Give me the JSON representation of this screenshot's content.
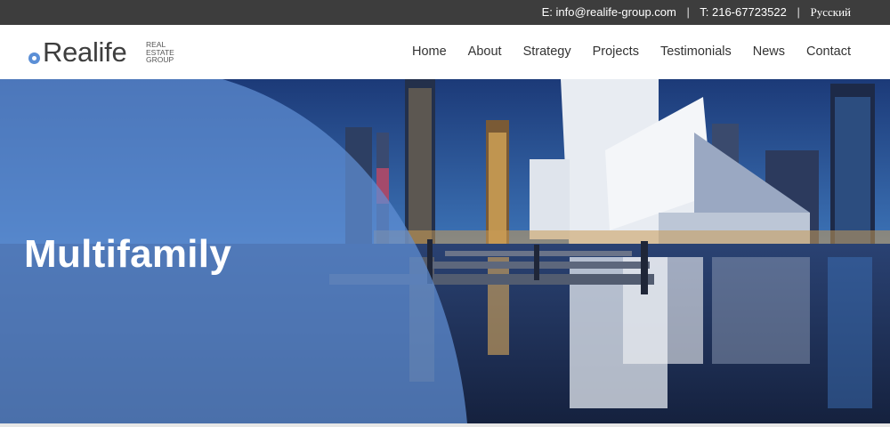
{
  "topbar": {
    "email": "E: info@realife-group.com",
    "separator": "|",
    "phone": "T: 216-67723522",
    "language": "Русский"
  },
  "logo": {
    "wordmark": "Realife",
    "tagline_line1": "REAL",
    "tagline_line2": "ESTATE",
    "tagline_line3": "GROUP"
  },
  "nav": {
    "items": [
      {
        "label": "Home"
      },
      {
        "label": "About"
      },
      {
        "label": "Strategy"
      },
      {
        "label": "Projects"
      },
      {
        "label": "Testimonials"
      },
      {
        "label": "News"
      },
      {
        "label": "Contact"
      }
    ]
  },
  "hero": {
    "title": "Multifamily"
  },
  "colors": {
    "topbar_bg": "#3d3d3d",
    "brand_blue": "#5b8fd6",
    "overlay_blue": "#5f8fd4"
  }
}
